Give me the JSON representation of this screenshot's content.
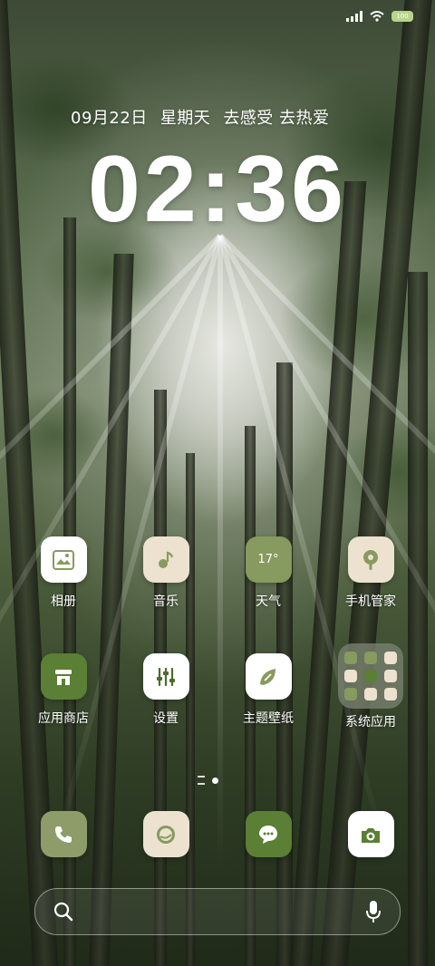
{
  "status_bar": {
    "battery_label": "100",
    "signal": "signal-icon",
    "wifi": "wifi-icon"
  },
  "lock": {
    "date": "09月22日",
    "weekday": "星期天",
    "slogan": "去感受 去热爱",
    "time": "02:36"
  },
  "apps": [
    {
      "label": "相册",
      "icon": "gallery-icon",
      "color": "#ffffff"
    },
    {
      "label": "音乐",
      "icon": "music-icon",
      "color": "#ece2cf"
    },
    {
      "label": "天气",
      "icon": "weather-icon",
      "color": "#879a5f",
      "value": "17°"
    },
    {
      "label": "手机管家",
      "icon": "security-icon",
      "color": "#ece2cf"
    },
    {
      "label": "应用商店",
      "icon": "store-icon",
      "color": "#5a7f35"
    },
    {
      "label": "设置",
      "icon": "settings-icon",
      "color": "#ffffff"
    },
    {
      "label": "主题壁纸",
      "icon": "themes-icon",
      "color": "#ffffff"
    },
    {
      "label": "系统应用",
      "icon": "folder-icon",
      "color": "#78806e"
    }
  ],
  "dock": [
    {
      "icon": "phone-icon",
      "color": "#8e9c6a"
    },
    {
      "icon": "browser-icon",
      "color": "#ece2cf"
    },
    {
      "icon": "messages-icon",
      "color": "#5a7f35"
    },
    {
      "icon": "camera-icon",
      "color": "#ffffff"
    }
  ],
  "search": {
    "icon": "search-icon",
    "mic": "mic-icon"
  }
}
